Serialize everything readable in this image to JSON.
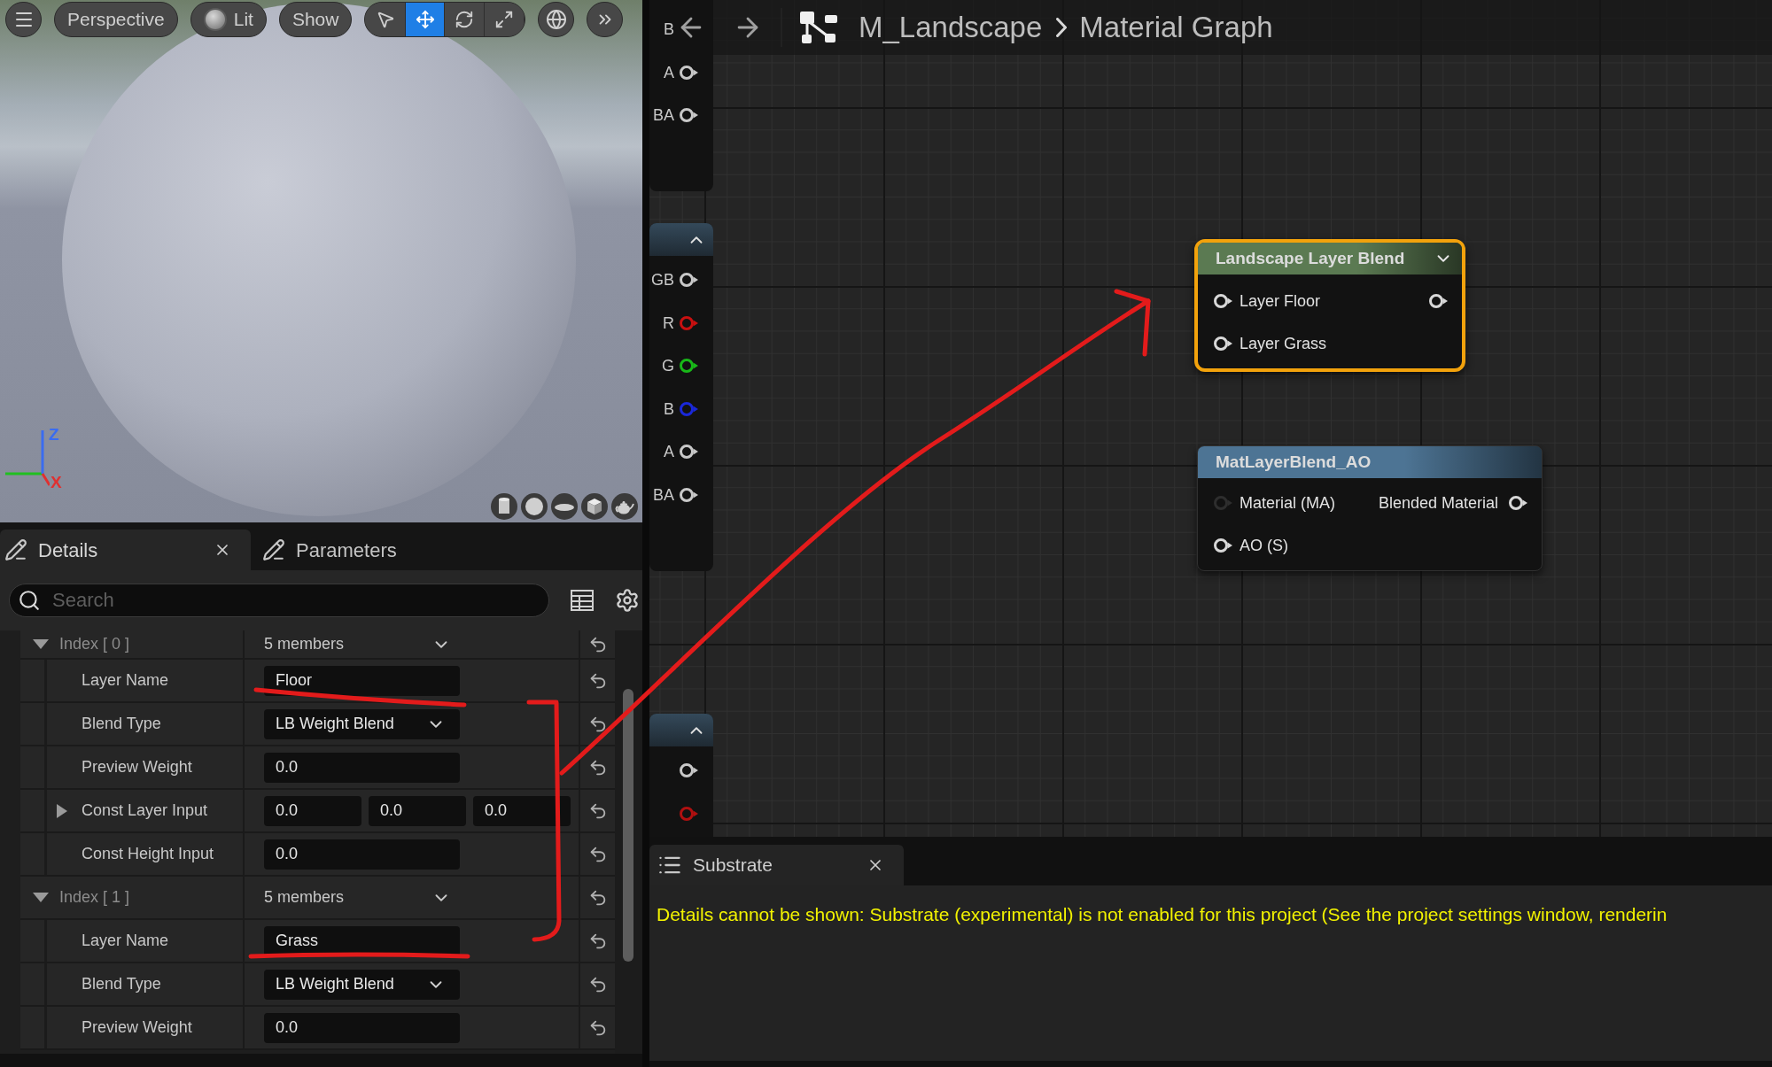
{
  "viewport": {
    "toolbar": {
      "view_buttons": [
        {
          "kind": "text",
          "label": "Perspective"
        },
        {
          "kind": "lit",
          "label": "Lit"
        },
        {
          "kind": "text",
          "label": "Show"
        }
      ],
      "transform_tools": [
        {
          "selected": false
        },
        {
          "selected": true
        },
        {
          "selected": false
        },
        {
          "selected": false
        }
      ]
    },
    "gizmo": {
      "axes": [
        {
          "label": "Z",
          "color": "#3a6cf0"
        },
        {
          "label": "X",
          "color": "#e03030"
        }
      ]
    }
  },
  "details": {
    "tabs": [
      {
        "label": "Details",
        "selected": true,
        "closable": true
      },
      {
        "label": "Parameters",
        "selected": false,
        "closable": false
      }
    ],
    "search": {
      "placeholder": "Search"
    },
    "properties": [
      {
        "kind": "group",
        "label": "Index [ 0 ]",
        "value": "5 members",
        "expanded": true,
        "children": [
          {
            "kind": "text",
            "label": "Layer Name",
            "value": "Floor"
          },
          {
            "kind": "dropdown",
            "label": "Blend Type",
            "value": "LB Weight Blend"
          },
          {
            "kind": "number",
            "label": "Preview Weight",
            "value": "0.0"
          },
          {
            "kind": "vector",
            "label": "Const Layer Input",
            "values": [
              "0.0",
              "0.0",
              "0.0"
            ],
            "expanded": false
          },
          {
            "kind": "number",
            "label": "Const Height Input",
            "value": "0.0"
          }
        ]
      },
      {
        "kind": "group",
        "label": "Index [ 1 ]",
        "value": "5 members",
        "expanded": true,
        "children": [
          {
            "kind": "text",
            "label": "Layer Name",
            "value": "Grass"
          },
          {
            "kind": "dropdown",
            "label": "Blend Type",
            "value": "LB Weight Blend"
          },
          {
            "kind": "number",
            "label": "Preview Weight",
            "value": "0.0"
          }
        ]
      }
    ]
  },
  "graph": {
    "breadcrumb": [
      "M_Landscape",
      "Material Graph"
    ],
    "pin_panels": [
      {
        "pins": [
          {
            "label": "B"
          },
          {
            "label": "A",
            "color": "#c8c8c8"
          },
          {
            "label": "BA",
            "color": "#c8c8c8"
          }
        ]
      },
      {
        "expanded": true,
        "pins": [
          {
            "label": "GB",
            "color": "#c8c8c8"
          },
          {
            "label": "R",
            "color": "#c81010"
          },
          {
            "label": "G",
            "color": "#18b818"
          },
          {
            "label": "B",
            "color": "#1a28d8"
          },
          {
            "label": "A",
            "color": "#c8c8c8"
          },
          {
            "label": "BA",
            "color": "#c8c8c8"
          }
        ]
      },
      {
        "expanded": true,
        "pins": [
          {
            "color": "#c8c8c8"
          },
          {
            "color": "#b01010"
          }
        ]
      }
    ],
    "nodes": [
      {
        "title": "Landscape Layer Blend",
        "color": "#5b7a52",
        "selected": true,
        "menu": true,
        "rows": [
          {
            "input": {
              "label": "Layer Floor",
              "color": "#d8d8d8"
            },
            "output": {
              "color": "#d8d8d8"
            }
          },
          {
            "input": {
              "label": "Layer Grass",
              "color": "#d8d8d8"
            }
          }
        ]
      },
      {
        "title": "MatLayerBlend_AO",
        "color": "#4d7494",
        "selected": false,
        "menu": false,
        "rows": [
          {
            "input": {
              "label": "Material (MA)",
              "color": "#2e2e2e"
            },
            "output": {
              "label": "Blended Material",
              "color": "#d8d8d8"
            }
          },
          {
            "input": {
              "label": "AO (S)",
              "color": "#d8d8d8"
            }
          }
        ]
      }
    ]
  },
  "substrate": {
    "tab": {
      "label": "Substrate",
      "selected": true,
      "closable": true
    },
    "message": "Details cannot be shown: Substrate (experimental) is not enabled for this project (See the project settings window, renderin"
  }
}
